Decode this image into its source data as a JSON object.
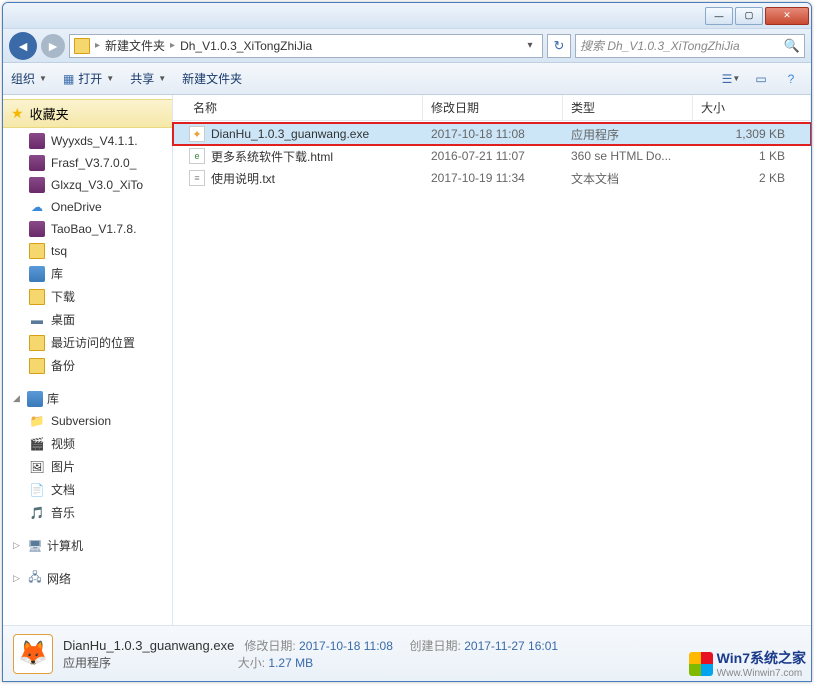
{
  "titlebar": {
    "min": "—",
    "max": "▢",
    "close": "✕"
  },
  "nav": {
    "breadcrumb": [
      "新建文件夹",
      "Dh_V1.0.3_XiTongZhiJia"
    ],
    "search_placeholder": "搜索 Dh_V1.0.3_XiTongZhiJia"
  },
  "toolbar": {
    "organize": "组织",
    "open": "打开",
    "share": "共享",
    "newfolder": "新建文件夹"
  },
  "sidebar": {
    "favorites": "收藏夹",
    "fav_items": [
      "Wyyxds_V4.1.1.",
      "Frasf_V3.7.0.0_",
      "Glxzq_V3.0_XiTo",
      "OneDrive",
      "TaoBao_V1.7.8.",
      "tsq",
      "库",
      "下载",
      "桌面",
      "最近访问的位置",
      "备份"
    ],
    "libraries": "库",
    "lib_items": [
      "Subversion",
      "视频",
      "图片",
      "文档",
      "音乐"
    ],
    "computer": "计算机",
    "network": "网络"
  },
  "columns": {
    "name": "名称",
    "date": "修改日期",
    "type": "类型",
    "size": "大小"
  },
  "files": [
    {
      "icon": "exe",
      "name": "DianHu_1.0.3_guanwang.exe",
      "date": "2017-10-18 11:08",
      "type": "应用程序",
      "size": "1,309 KB",
      "selected": true,
      "highlighted": true
    },
    {
      "icon": "html",
      "name": "更多系统软件下载.html",
      "date": "2016-07-21 11:07",
      "type": "360 se HTML Do...",
      "size": "1 KB",
      "selected": false,
      "highlighted": false
    },
    {
      "icon": "txt",
      "name": "使用说明.txt",
      "date": "2017-10-19 11:34",
      "type": "文本文档",
      "size": "2 KB",
      "selected": false,
      "highlighted": false
    }
  ],
  "details": {
    "name": "DianHu_1.0.3_guanwang.exe",
    "type": "应用程序",
    "mod_label": "修改日期:",
    "mod_val": "2017-10-18 11:08",
    "size_label": "大小:",
    "size_val": "1.27 MB",
    "create_label": "创建日期:",
    "create_val": "2017-11-27 16:01"
  },
  "watermark": {
    "brand": "Win7系统之家",
    "url": "Www.Winwin7.com"
  }
}
